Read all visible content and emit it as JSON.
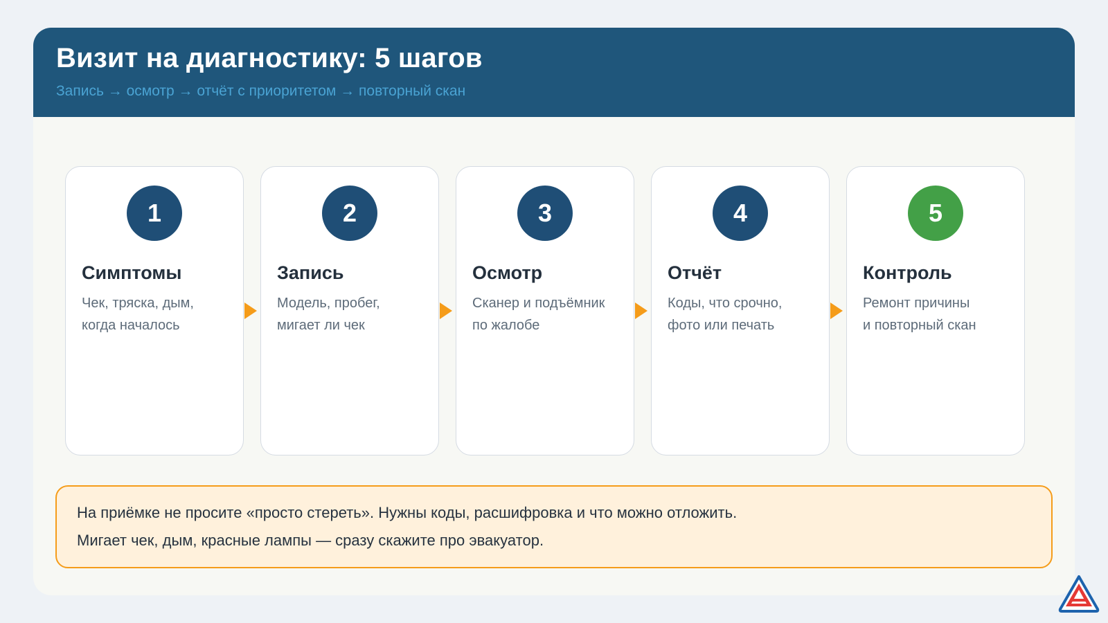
{
  "header": {
    "title": "Визит на диагностику: 5 шагов",
    "subtitle": "Запись → осмотр → отчёт с приоритетом → повторный скан"
  },
  "steps": [
    {
      "number": "1",
      "title": "Симптомы",
      "line1": "Чек, тряска, дым,",
      "line2": "когда началось"
    },
    {
      "number": "2",
      "title": "Запись",
      "line1": "Модель, пробег,",
      "line2": "мигает ли чек"
    },
    {
      "number": "3",
      "title": "Осмотр",
      "line1": "Сканер и подъёмник",
      "line2": "по жалобе"
    },
    {
      "number": "4",
      "title": "Отчёт",
      "line1": "Коды, что срочно,",
      "line2": "фото или печать"
    },
    {
      "number": "5",
      "title": "Контроль",
      "line1": "Ремонт причины",
      "line2": "и повторный скан"
    }
  ],
  "note": {
    "line1": "На приёмке не просите «просто стереть». Нужны коды, расшифровка и что можно отложить.",
    "line2": "Мигает чек, дым, красные лампы — сразу скажите про эвакуатор."
  },
  "colors": {
    "header_bg": "#1f567b",
    "badge": "#1f4e76",
    "badge_final": "#43a047",
    "arrow": "#f59c1a",
    "note_bg": "#fff1dc"
  },
  "icons": {
    "step_arrow": "arrow-right-icon",
    "logo": "brand-logo-icon"
  }
}
